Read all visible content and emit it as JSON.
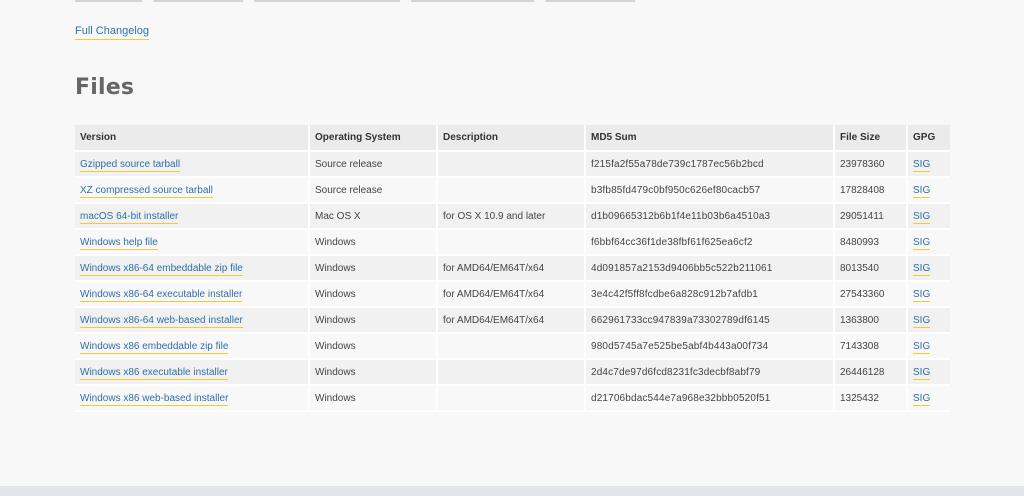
{
  "links": {
    "full_changelog": "Full Changelog"
  },
  "files": {
    "title": "Files",
    "columns": [
      "Version",
      "Operating System",
      "Description",
      "MD5 Sum",
      "File Size",
      "GPG"
    ],
    "rows": [
      {
        "version": "Gzipped source tarball",
        "os": "Source release",
        "description": "",
        "md5": "f215fa2f55a78de739c1787ec56b2bcd",
        "size": "23978360",
        "gpg": "SIG"
      },
      {
        "version": "XZ compressed source tarball",
        "os": "Source release",
        "description": "",
        "md5": "b3fb85fd479c0bf950c626ef80cacb57",
        "size": "17828408",
        "gpg": "SIG"
      },
      {
        "version": "macOS 64-bit installer",
        "os": "Mac OS X",
        "description": "for OS X 10.9 and later",
        "md5": "d1b09665312b6b1f4e11b03b6a4510a3",
        "size": "29051411",
        "gpg": "SIG"
      },
      {
        "version": "Windows help file",
        "os": "Windows",
        "description": "",
        "md5": "f6bbf64cc36f1de38fbf61f625ea6cf2",
        "size": "8480993",
        "gpg": "SIG"
      },
      {
        "version": "Windows x86-64 embeddable zip file",
        "os": "Windows",
        "description": "for AMD64/EM64T/x64",
        "md5": "4d091857a2153d9406bb5c522b211061",
        "size": "8013540",
        "gpg": "SIG"
      },
      {
        "version": "Windows x86-64 executable installer",
        "os": "Windows",
        "description": "for AMD64/EM64T/x64",
        "md5": "3e4c42f5ff8fcdbe6a828c912b7afdb1",
        "size": "27543360",
        "gpg": "SIG"
      },
      {
        "version": "Windows x86-64 web-based installer",
        "os": "Windows",
        "description": "for AMD64/EM64T/x64",
        "md5": "662961733cc947839a73302789df6145",
        "size": "1363800",
        "gpg": "SIG"
      },
      {
        "version": "Windows x86 embeddable zip file",
        "os": "Windows",
        "description": "",
        "md5": "980d5745a7e525be5abf4b443a00f734",
        "size": "7143308",
        "gpg": "SIG"
      },
      {
        "version": "Windows x86 executable installer",
        "os": "Windows",
        "description": "",
        "md5": "2d4c7de97d6fcd8231fc3decbf8abf79",
        "size": "26446128",
        "gpg": "SIG"
      },
      {
        "version": "Windows x86 web-based installer",
        "os": "Windows",
        "description": "",
        "md5": "d21706bdac544e7a968e32bbb0520f51",
        "size": "1325432",
        "gpg": "SIG"
      }
    ]
  },
  "colors": {
    "link": "#2f6fa8",
    "link_underline": "#f4c93a",
    "header_bg": "#ebebeb",
    "row_bg": "#f1f1f1"
  }
}
